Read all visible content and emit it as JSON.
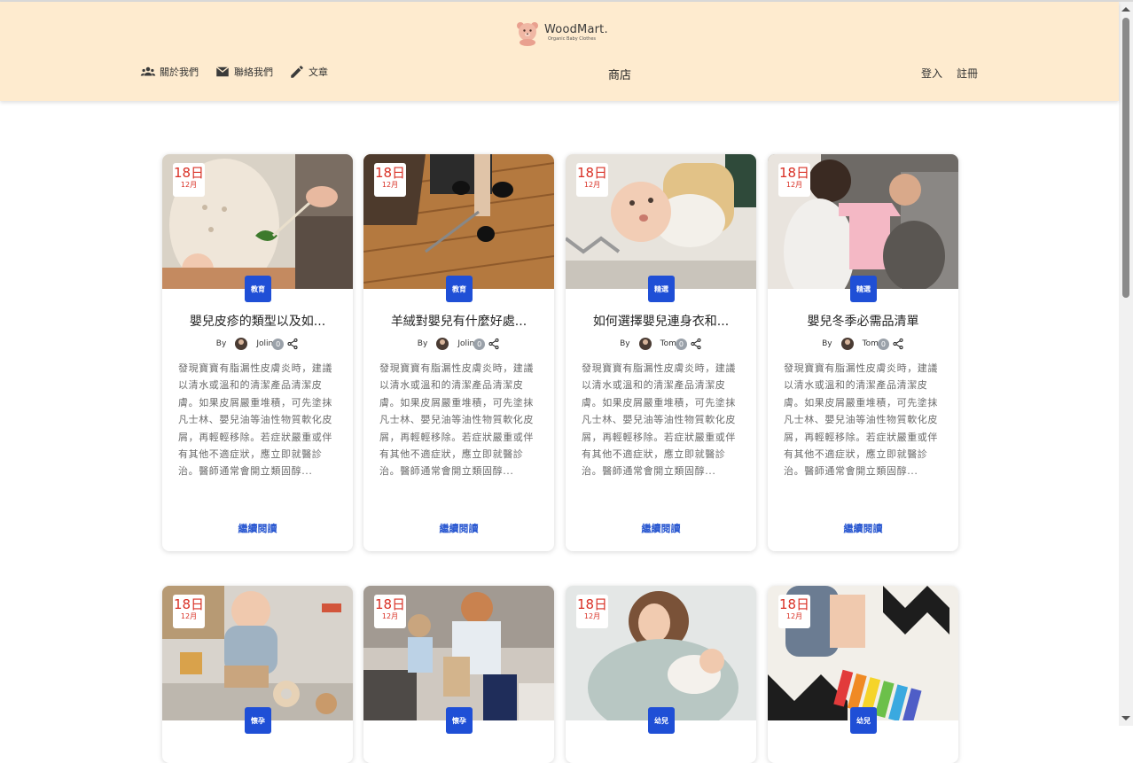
{
  "brand": {
    "name": "WoodMart.",
    "tagline": "Organic Baby Clothes"
  },
  "nav": {
    "left": [
      {
        "label": "關於我們",
        "icon": "people-icon"
      },
      {
        "label": "聯絡我們",
        "icon": "mail-icon"
      },
      {
        "label": "文章",
        "icon": "pencil-icon"
      }
    ],
    "center": "商店",
    "right": [
      "登入",
      "註冊"
    ]
  },
  "colors": {
    "header_bg": "#feebcf",
    "category_badge": "#1f4fd6",
    "date_text": "#d93025",
    "link": "#2b59d1"
  },
  "posts": [
    {
      "day": "18日",
      "month": "12月",
      "category": "教育",
      "title": "嬰兒皮疹的類型以及如...",
      "by": "By",
      "author": "Jolin",
      "comments": "0",
      "excerpt": "發現寶寶有脂漏性皮膚炎時，建議以清水或溫和的清潔產品清潔皮膚。如果皮屑嚴重堆積，可先塗抹凡士林、嬰兒油等油性物質軟化皮屑，再輕輕移除。若症狀嚴重或伴有其他不適症狀，應立即就醫診治。醫師通常會開立類固醇...",
      "read_more": "繼續閱讀",
      "image": "baby-with-leaf-photo"
    },
    {
      "day": "18日",
      "month": "12月",
      "category": "教育",
      "title": "羊絨對嬰兒有什麼好處...",
      "by": "By",
      "author": "Jolin",
      "comments": "0",
      "excerpt": "發現寶寶有脂漏性皮膚炎時，建議以清水或溫和的清潔產品清潔皮膚。如果皮屑嚴重堆積，可先塗抹凡士林、嬰兒油等油性物質軟化皮屑，再輕輕移除。若症狀嚴重或伴有其他不適症狀，應立即就醫診治。醫師通常會開立類固醇...",
      "read_more": "繼續閱讀",
      "image": "child-on-wood-floor-photo"
    },
    {
      "day": "18日",
      "month": "12月",
      "category": "精選",
      "title": "如何選擇嬰兒連身衣和...",
      "by": "By",
      "author": "Tom",
      "comments": "0",
      "excerpt": "發現寶寶有脂漏性皮膚炎時，建議以清水或溫和的清潔產品清潔皮膚。如果皮屑嚴重堆積，可先塗抹凡士林、嬰兒油等油性物質軟化皮屑，再輕輕移除。若症狀嚴重或伴有其他不適症狀，應立即就醫診治。醫師通常會開立類固醇...",
      "read_more": "繼續閱讀",
      "image": "baby-lying-photo"
    },
    {
      "day": "18日",
      "month": "12月",
      "category": "精選",
      "title": "嬰兒冬季必需品清單",
      "by": "By",
      "author": "Tom",
      "comments": "0",
      "excerpt": "發現寶寶有脂漏性皮膚炎時，建議以清水或溫和的清潔產品清潔皮膚。如果皮屑嚴重堆積，可先塗抹凡士林、嬰兒油等油性物質軟化皮屑，再輕輕移除。若症狀嚴重或伴有其他不適症狀，應立即就醫診治。醫師通常會開立類固醇...",
      "read_more": "繼續閱讀",
      "image": "parents-with-pink-onesie-photo"
    },
    {
      "day": "18日",
      "month": "12月",
      "category": "懷孕",
      "title": "",
      "by": "",
      "author": "",
      "comments": "",
      "excerpt": "",
      "read_more": "",
      "image": "baby-playing-toys-photo"
    },
    {
      "day": "18日",
      "month": "12月",
      "category": "懷孕",
      "title": "",
      "by": "",
      "author": "",
      "comments": "",
      "excerpt": "",
      "read_more": "",
      "image": "mother-and-toddler-shopping-photo"
    },
    {
      "day": "18日",
      "month": "12月",
      "category": "幼兒",
      "title": "",
      "by": "",
      "author": "",
      "comments": "",
      "excerpt": "",
      "read_more": "",
      "image": "mother-holding-newborn-photo"
    },
    {
      "day": "18日",
      "month": "12月",
      "category": "幼兒",
      "title": "",
      "by": "",
      "author": "",
      "comments": "",
      "excerpt": "",
      "read_more": "",
      "image": "child-xylophone-photo"
    }
  ]
}
